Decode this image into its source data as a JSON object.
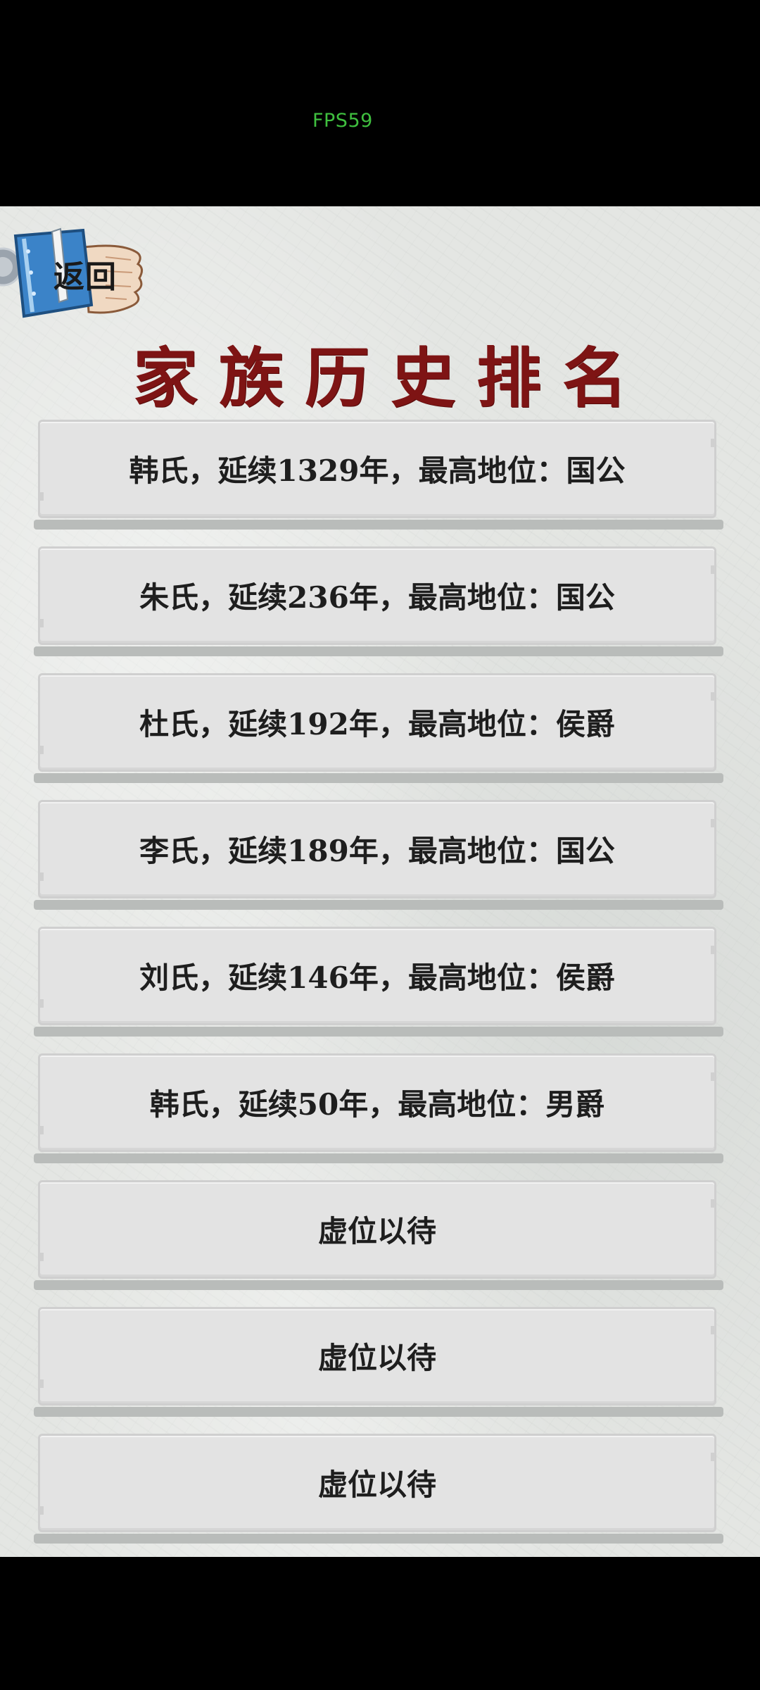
{
  "status": {
    "fps": "FPS59"
  },
  "header": {
    "back_label": "返回",
    "title": "家族历史排名"
  },
  "rankings": [
    {
      "text": "韩氏，延续1329年，最高地位：国公"
    },
    {
      "text": "朱氏，延续236年，最高地位：国公"
    },
    {
      "text": "杜氏，延续192年，最高地位：侯爵"
    },
    {
      "text": "李氏，延续189年，最高地位：国公"
    },
    {
      "text": "刘氏，延续146年，最高地位：侯爵"
    },
    {
      "text": "韩氏，延续50年，最高地位：男爵"
    },
    {
      "text": "虚位以待"
    },
    {
      "text": "虚位以待"
    },
    {
      "text": "虚位以待"
    }
  ],
  "colors": {
    "title": "#7e1414",
    "fps": "#3fbf3f",
    "background": "#e4e6e3",
    "plate": "#e3e3e3"
  },
  "icons": {
    "back": "book-scroll-icon",
    "floating": "assistive-ball-icon"
  }
}
